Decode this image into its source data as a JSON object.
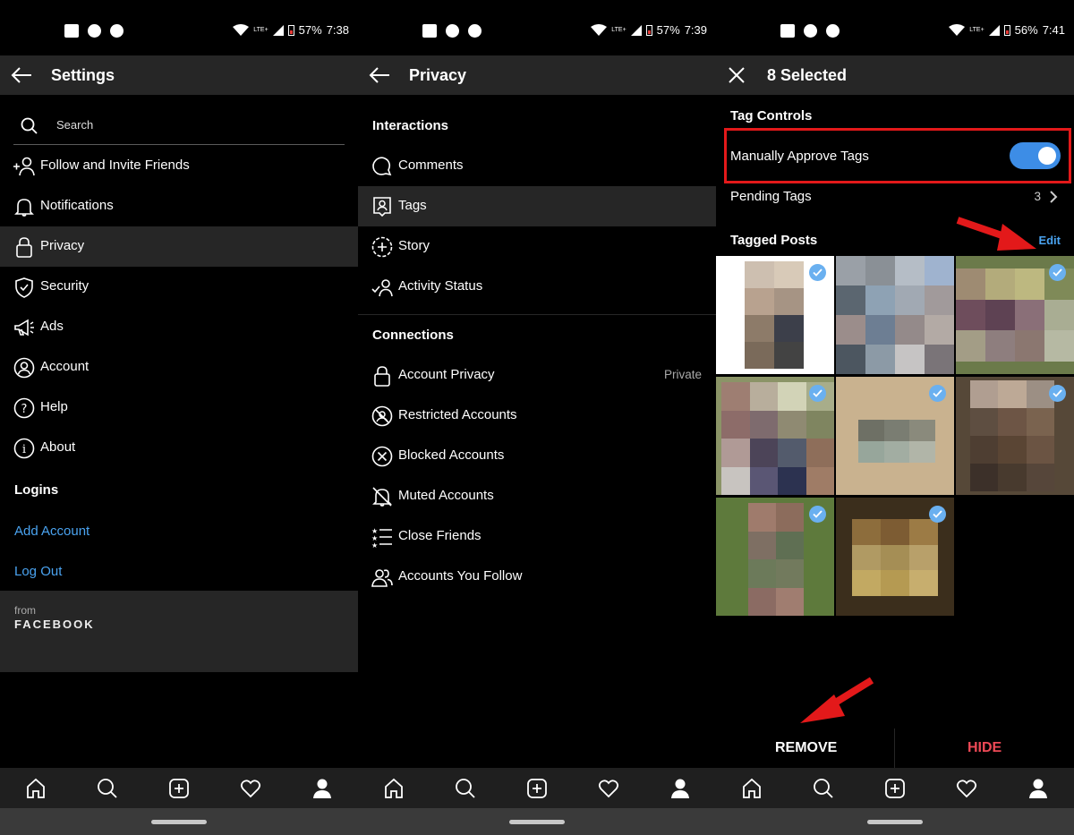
{
  "panels": [
    {
      "status": {
        "battery": "57%",
        "time": "7:38",
        "network": "LTE+"
      },
      "title": "Settings",
      "search_placeholder": "Search",
      "items": [
        {
          "label": "Follow and Invite Friends",
          "icon": "add-person-icon"
        },
        {
          "label": "Notifications",
          "icon": "bell-icon"
        },
        {
          "label": "Privacy",
          "icon": "lock-icon",
          "active": true
        },
        {
          "label": "Security",
          "icon": "shield-icon"
        },
        {
          "label": "Ads",
          "icon": "megaphone-icon"
        },
        {
          "label": "Account",
          "icon": "person-circle-icon"
        },
        {
          "label": "Help",
          "icon": "help-icon"
        },
        {
          "label": "About",
          "icon": "info-icon"
        }
      ],
      "logins_heading": "Logins",
      "add_account": "Add Account",
      "log_out": "Log Out",
      "footer": {
        "from": "from",
        "brand": "FACEBOOK"
      }
    },
    {
      "status": {
        "battery": "57%",
        "time": "7:39",
        "network": "LTE+"
      },
      "title": "Privacy",
      "interactions_heading": "Interactions",
      "interactions": [
        {
          "label": "Comments",
          "icon": "comment-icon"
        },
        {
          "label": "Tags",
          "icon": "tag-person-icon",
          "active": true
        },
        {
          "label": "Story",
          "icon": "story-icon"
        },
        {
          "label": "Activity Status",
          "icon": "activity-status-icon"
        }
      ],
      "connections_heading": "Connections",
      "connections": [
        {
          "label": "Account Privacy",
          "icon": "lock-icon",
          "value": "Private"
        },
        {
          "label": "Restricted Accounts",
          "icon": "restricted-icon"
        },
        {
          "label": "Blocked Accounts",
          "icon": "blocked-icon"
        },
        {
          "label": "Muted Accounts",
          "icon": "muted-bell-icon"
        },
        {
          "label": "Close Friends",
          "icon": "star-list-icon"
        },
        {
          "label": "Accounts You Follow",
          "icon": "people-icon"
        }
      ]
    },
    {
      "status": {
        "battery": "56%",
        "time": "7:41",
        "network": "LTE+"
      },
      "title": "8 Selected",
      "tag_controls_heading": "Tag Controls",
      "manually_approve_label": "Manually Approve Tags",
      "manually_approve_on": true,
      "pending_tags_label": "Pending Tags",
      "pending_tags_count": "3",
      "tagged_posts_heading": "Tagged Posts",
      "edit_label": "Edit",
      "remove_label": "REMOVE",
      "hide_label": "HIDE",
      "selected_count": 8
    }
  ],
  "nav_icons": [
    "home-icon",
    "search-icon",
    "new-post-icon",
    "heart-icon",
    "profile-icon"
  ],
  "colors": {
    "link": "#4aa3f0",
    "toggle": "#3d8de6",
    "highlight_box": "#e3191a",
    "hide": "#ed4956",
    "check": "#6ab0f0"
  }
}
